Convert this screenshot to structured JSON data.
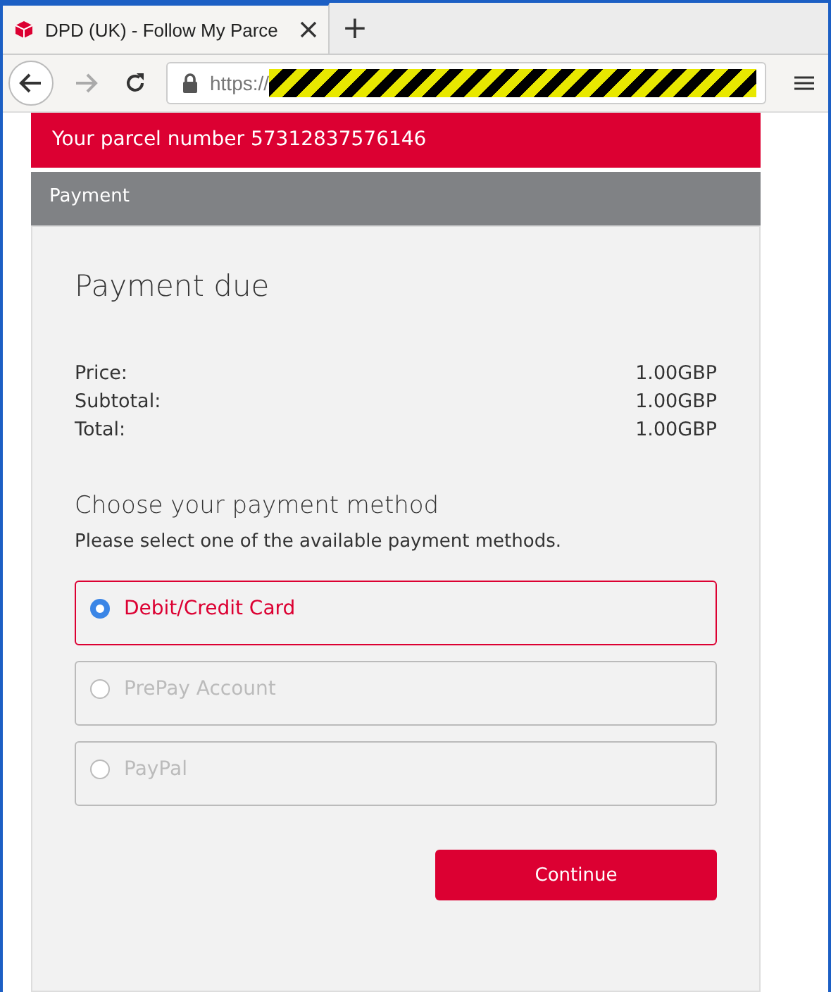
{
  "browser": {
    "tab_title": "DPD (UK) - Follow My Parce",
    "new_tab": "+",
    "url_prefix": "https://"
  },
  "banner": "Your parcel number 57312837576146",
  "section": "Payment",
  "heading": "Payment due",
  "totals": [
    {
      "label": "Price:",
      "value": "1.00GBP"
    },
    {
      "label": "Subtotal:",
      "value": "1.00GBP"
    },
    {
      "label": "Total:",
      "value": "1.00GBP"
    }
  ],
  "method_heading": "Choose your payment method",
  "method_hint": "Please select one of the available payment methods.",
  "methods": [
    {
      "label": "Debit/Credit Card",
      "selected": true
    },
    {
      "label": "PrePay Account",
      "selected": false
    },
    {
      "label": "PayPal",
      "selected": false
    }
  ],
  "continue_button": "Continue"
}
